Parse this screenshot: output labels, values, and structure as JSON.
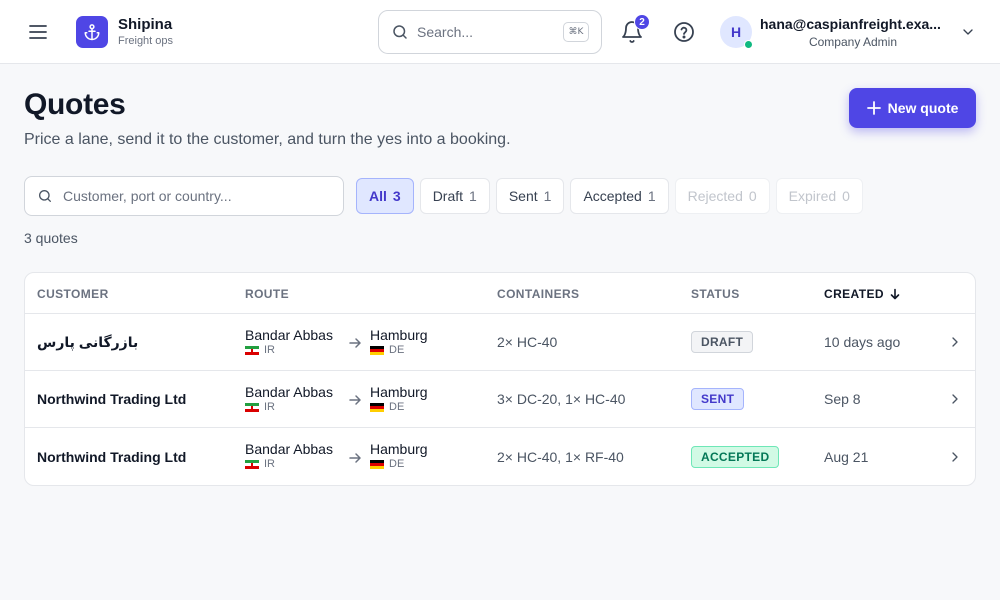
{
  "app": {
    "name": "Shipina",
    "subtitle": "Freight ops"
  },
  "topbar": {
    "search_placeholder": "Search...",
    "search_shortcut": "⌘K",
    "notification_count": "2",
    "user": {
      "initial": "H",
      "email": "hana@caspianfreight.exa...",
      "role": "Company Admin",
      "online": true
    }
  },
  "page": {
    "title": "Quotes",
    "subtitle": "Price a lane, send it to the customer, and turn the yes into a booking.",
    "new_quote_label": "New quote"
  },
  "filters": {
    "search_placeholder": "Customer, port or country...",
    "chips": [
      {
        "label": "All",
        "count": "3",
        "state": "active"
      },
      {
        "label": "Draft",
        "count": "1",
        "state": "normal"
      },
      {
        "label": "Sent",
        "count": "1",
        "state": "normal"
      },
      {
        "label": "Accepted",
        "count": "1",
        "state": "normal"
      },
      {
        "label": "Rejected",
        "count": "0",
        "state": "disabled"
      },
      {
        "label": "Expired",
        "count": "0",
        "state": "disabled"
      }
    ],
    "result_count": "3 quotes"
  },
  "table": {
    "columns": {
      "customer": "CUSTOMER",
      "route": "ROUTE",
      "containers": "CONTAINERS",
      "status": "STATUS",
      "created": "CREATED"
    },
    "sort": {
      "column": "created",
      "direction": "desc"
    },
    "rows": [
      {
        "customer": "بازرگانی پارس",
        "origin": {
          "port": "Bandar Abbas",
          "country": "IR",
          "flag": "flag-ir"
        },
        "destination": {
          "port": "Hamburg",
          "country": "DE",
          "flag": "flag-de"
        },
        "containers": "2× HC-40",
        "status": "DRAFT",
        "status_style": "draft",
        "created": "10 days ago"
      },
      {
        "customer": "Northwind Trading Ltd",
        "origin": {
          "port": "Bandar Abbas",
          "country": "IR",
          "flag": "flag-ir"
        },
        "destination": {
          "port": "Hamburg",
          "country": "DE",
          "flag": "flag-de"
        },
        "containers": "3× DC-20, 1× HC-40",
        "status": "SENT",
        "status_style": "sent",
        "created": "Sep 8"
      },
      {
        "customer": "Northwind Trading Ltd",
        "origin": {
          "port": "Bandar Abbas",
          "country": "IR",
          "flag": "flag-ir"
        },
        "destination": {
          "port": "Hamburg",
          "country": "DE",
          "flag": "flag-de"
        },
        "containers": "2× HC-40, 1× RF-40",
        "status": "ACCEPTED",
        "status_style": "accepted",
        "created": "Aug 21"
      }
    ]
  },
  "colors": {
    "accent": "#4f46e5",
    "draft": "#4b5563",
    "sent": "#4338ca",
    "accepted": "#047857",
    "online": "#10b981"
  }
}
